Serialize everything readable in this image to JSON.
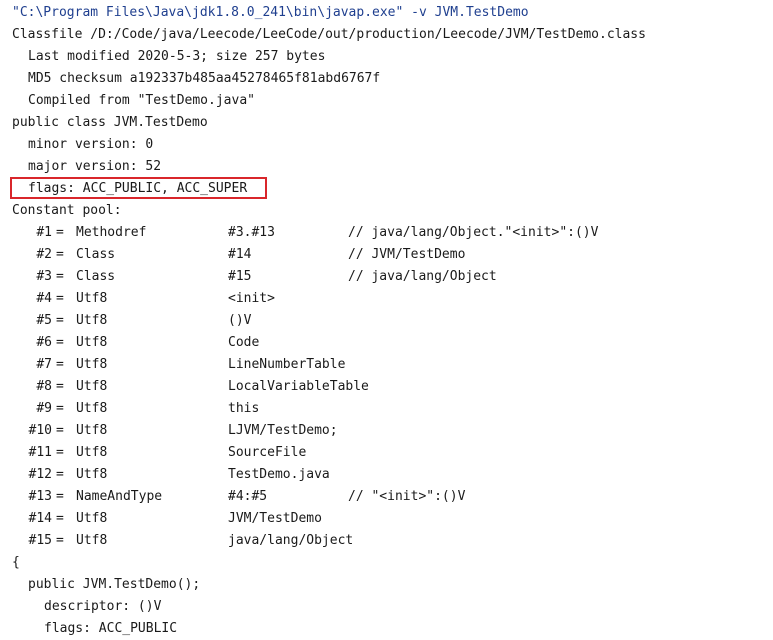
{
  "command": "\"C:\\Program Files\\Java\\jdk1.8.0_241\\bin\\javap.exe\" -v JVM.TestDemo",
  "header": {
    "classfile": "Classfile /D:/Code/java/Leecode/LeeCode/out/production/Leecode/JVM/TestDemo.class",
    "last_modified": "Last modified 2020-5-3; size 257 bytes",
    "md5": "MD5 checksum a192337b485aa45278465f81abd6767f",
    "compiled_from": "Compiled from \"TestDemo.java\""
  },
  "class_decl": "public class JVM.TestDemo",
  "versions": {
    "minor": "minor version: 0",
    "major": "major version: 52"
  },
  "flags": "flags: ACC_PUBLIC, ACC_SUPER",
  "constant_pool": {
    "title": "Constant pool:",
    "entries": [
      {
        "idx": "#1",
        "type": "Methodref",
        "value": "#3.#13",
        "comment": "// java/lang/Object.\"<init>\":()V"
      },
      {
        "idx": "#2",
        "type": "Class",
        "value": "#14",
        "comment": "// JVM/TestDemo"
      },
      {
        "idx": "#3",
        "type": "Class",
        "value": "#15",
        "comment": "// java/lang/Object"
      },
      {
        "idx": "#4",
        "type": "Utf8",
        "value": "<init>",
        "comment": ""
      },
      {
        "idx": "#5",
        "type": "Utf8",
        "value": "()V",
        "comment": ""
      },
      {
        "idx": "#6",
        "type": "Utf8",
        "value": "Code",
        "comment": ""
      },
      {
        "idx": "#7",
        "type": "Utf8",
        "value": "LineNumberTable",
        "comment": ""
      },
      {
        "idx": "#8",
        "type": "Utf8",
        "value": "LocalVariableTable",
        "comment": ""
      },
      {
        "idx": "#9",
        "type": "Utf8",
        "value": "this",
        "comment": ""
      },
      {
        "idx": "#10",
        "type": "Utf8",
        "value": "LJVM/TestDemo;",
        "comment": ""
      },
      {
        "idx": "#11",
        "type": "Utf8",
        "value": "SourceFile",
        "comment": ""
      },
      {
        "idx": "#12",
        "type": "Utf8",
        "value": "TestDemo.java",
        "comment": ""
      },
      {
        "idx": "#13",
        "type": "NameAndType",
        "value": "#4:#5",
        "comment": "// \"<init>\":()V"
      },
      {
        "idx": "#14",
        "type": "Utf8",
        "value": "JVM/TestDemo",
        "comment": ""
      },
      {
        "idx": "#15",
        "type": "Utf8",
        "value": "java/lang/Object",
        "comment": ""
      }
    ]
  },
  "body": {
    "open_brace": "{",
    "constructor": "public JVM.TestDemo();",
    "descriptor": "descriptor: ()V",
    "method_flags": "flags: ACC_PUBLIC"
  },
  "colors": {
    "highlight_box": "#d9262b",
    "command_text": "#1f3f8f"
  }
}
